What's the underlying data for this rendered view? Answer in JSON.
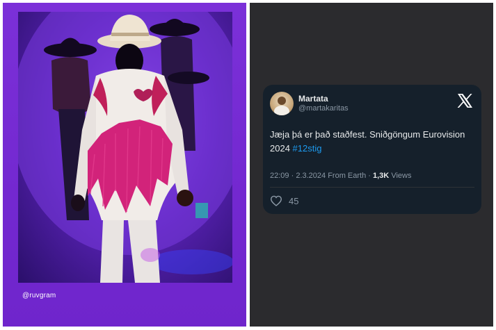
{
  "left": {
    "handle": "@ruvgram"
  },
  "tweet": {
    "display_name": "Martata",
    "username": "@martakaritas",
    "text_main": "Jæja þá er það staðfest. Sniðgöngum Eurovision 2024 ",
    "hashtag": "#12stig",
    "time": "22:09",
    "date": "2.3.2024",
    "location": "From Earth",
    "views_count": "1,3K",
    "views_label": "Views",
    "likes": "45",
    "icons": [
      "x-logo-icon",
      "heart-icon"
    ],
    "colors": {
      "card": "#15202b",
      "hashtag": "#1d9bf0",
      "panel": "#2b2b2e",
      "left_bg": "#7a2fd6"
    }
  }
}
